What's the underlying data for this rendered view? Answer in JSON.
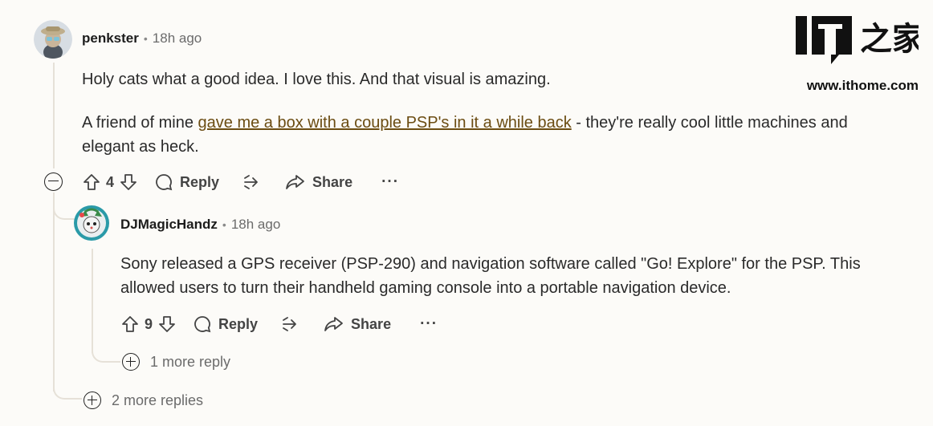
{
  "logo": {
    "text": "IT之家",
    "url": "www.ithome.com"
  },
  "comment1": {
    "username": "penkster",
    "time": "18h ago",
    "para1": "Holy cats what a good idea. I love this. And that visual is amazing.",
    "para2_prefix": "A friend of mine ",
    "para2_link": "gave me a box with a couple PSP's in it a while back",
    "para2_suffix": " - they're really cool little machines and",
    "para2_line2": "elegant as heck.",
    "votes": "4",
    "reply_label": "Reply",
    "share_label": "Share",
    "more": "2 more replies"
  },
  "comment2": {
    "username": "DJMagicHandz",
    "time": "18h ago",
    "line1": "Sony released a GPS receiver (PSP-290) and navigation software called \"Go! Explore\" for the PSP. This",
    "line2": "allowed users to turn their handheld gaming console into a portable navigation device.",
    "votes": "9",
    "reply_label": "Reply",
    "share_label": "Share",
    "more": "1 more reply"
  }
}
